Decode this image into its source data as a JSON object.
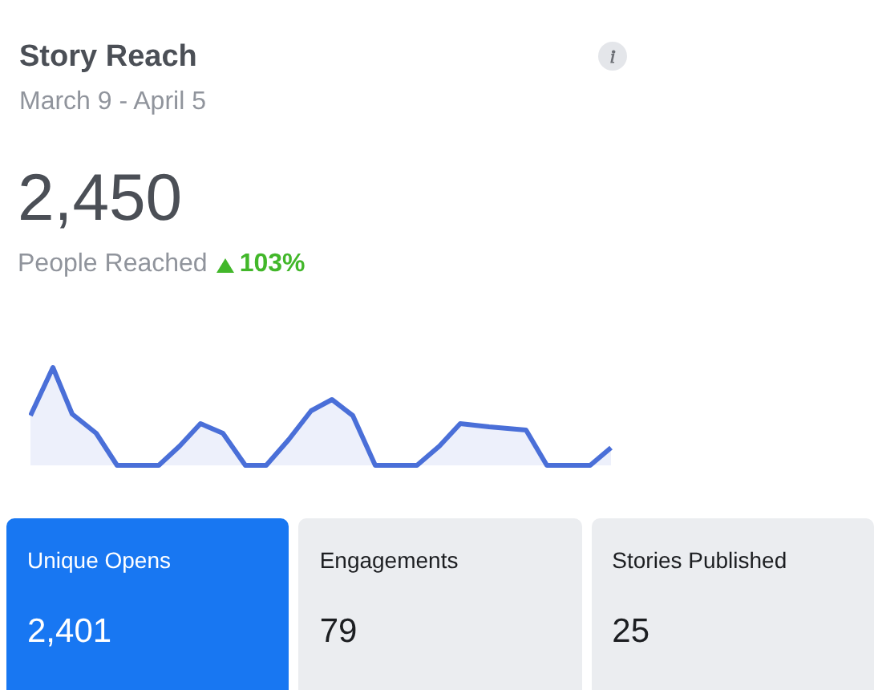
{
  "title": "Story Reach",
  "date_range": "March 9 - April 5",
  "total": "2,450",
  "total_label": "People Reached",
  "change": {
    "up": true,
    "value": "103%"
  },
  "cards": [
    {
      "label": "Unique Opens",
      "value": "2,401",
      "selected": true
    },
    {
      "label": "Engagements",
      "value": "79",
      "selected": false
    },
    {
      "label": "Stories Published",
      "value": "25",
      "selected": false
    }
  ]
}
